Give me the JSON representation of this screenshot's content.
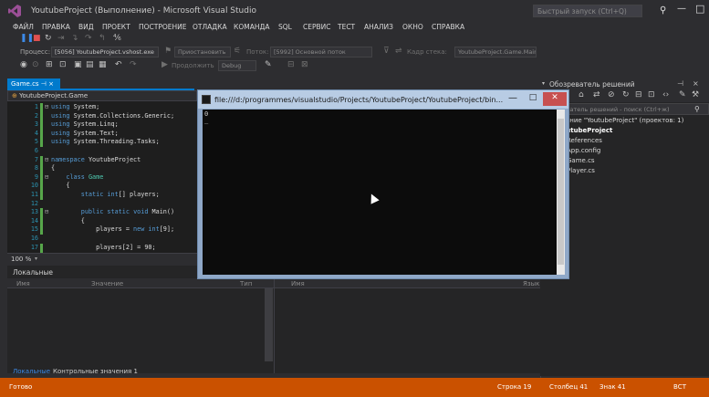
{
  "window": {
    "title": "YoutubeProject (Выполнение) - Microsoft Visual Studio",
    "quick_launch_placeholder": "Быстрый запуск (Ctrl+Q)"
  },
  "menu": [
    "ФАЙЛ",
    "ПРАВКА",
    "ВИД",
    "ПРОЕКТ",
    "ПОСТРОЕНИЕ",
    "ОТЛАДКА",
    "КОМАНДА",
    "SQL",
    "СЕРВИС",
    "ТЕСТ",
    "АНАЛИЗ",
    "ОКНО",
    "СПРАВКА"
  ],
  "toolbar": {
    "process_label": "Процесс:",
    "process_value": "[5056] YoutubeProject.vshost.exe",
    "lifecycle_label": "Приостановить",
    "thread_label": "Поток:",
    "thread_value": "[5992] Основной поток",
    "stack_label": "Кадр стека:",
    "stack_value": "YoutubeProject.Game.Main",
    "continue_label": "Продолжить",
    "config_value": "Debug"
  },
  "editor": {
    "tab_label": "Game.cs",
    "nav_value": "YoutubeProject.Game",
    "zoom": "100 %",
    "lines": [
      {
        "n": "1",
        "fold": "⊟",
        "chg": true,
        "code": "using System;"
      },
      {
        "n": "2",
        "fold": "",
        "chg": true,
        "code": "using System.Collections.Generic;"
      },
      {
        "n": "3",
        "fold": "",
        "chg": true,
        "code": "using System.Linq;"
      },
      {
        "n": "4",
        "fold": "",
        "chg": true,
        "code": "using System.Text;"
      },
      {
        "n": "5",
        "fold": "",
        "chg": true,
        "code": "using System.Threading.Tasks;"
      },
      {
        "n": "6",
        "fold": "",
        "chg": false,
        "code": ""
      },
      {
        "n": "7",
        "fold": "⊟",
        "chg": true,
        "code": "namespace YoutubeProject"
      },
      {
        "n": "8",
        "fold": "",
        "chg": true,
        "code": "{"
      },
      {
        "n": "9",
        "fold": "⊟",
        "chg": true,
        "code": "    class Game"
      },
      {
        "n": "10",
        "fold": "",
        "chg": true,
        "code": "    {"
      },
      {
        "n": "11",
        "fold": "",
        "chg": true,
        "code": "        static int[] players;"
      },
      {
        "n": "12",
        "fold": "",
        "chg": false,
        "code": ""
      },
      {
        "n": "13",
        "fold": "⊟",
        "chg": true,
        "code": "        public static void Main()"
      },
      {
        "n": "14",
        "fold": "",
        "chg": true,
        "code": "        {"
      },
      {
        "n": "15",
        "fold": "",
        "chg": true,
        "code": "            players = new int[9];"
      },
      {
        "n": "16",
        "fold": "",
        "chg": false,
        "code": ""
      },
      {
        "n": "17",
        "fold": "",
        "chg": true,
        "code": "            players[2] = 90;"
      }
    ]
  },
  "locals": {
    "title": "Локальные",
    "col_name": "Имя",
    "col_value": "Значение",
    "col_type": "Тип"
  },
  "pane2": {
    "col_name": "Имя",
    "col_lang": "Язык"
  },
  "bottom_tabs": {
    "locals": "Локальные",
    "watch": "Контрольные значения 1"
  },
  "solution_explorer": {
    "title": "Обозреватель решений",
    "search_placeholder": "Обозреватель решений - поиск (Ctrl+ж)",
    "items": [
      {
        "label": "Решение \"YoutubeProject\" (проектов: 1)",
        "icon": "▣",
        "color": "#d8d8d8"
      },
      {
        "label": "YoutubeProject",
        "icon": "◧",
        "color": "#ffffff",
        "bold": true
      },
      {
        "label": "References",
        "icon": "■",
        "color": "#d8d8d8"
      },
      {
        "label": "App.config",
        "icon": "▤",
        "color": "#d8d8d8"
      },
      {
        "label": "Game.cs",
        "icon": "c#",
        "color": "#d8d8d8"
      },
      {
        "label": "Player.cs",
        "icon": "c#",
        "color": "#d8d8d8"
      }
    ]
  },
  "console": {
    "title": "file:///d:/programmes/visualstudio/Projects/YoutubeProject/YoutubeProject/bin...",
    "output": "0\n_"
  },
  "statusbar": {
    "ready": "Готово",
    "line": "Строка 19",
    "col": "Столбец 41",
    "ch": "Знак 41",
    "mode": "ВСТ"
  },
  "colors": {
    "accent": "#007acc",
    "status_debug": "#ca5100",
    "keyword": "#569cd6",
    "type": "#4ec9b0"
  }
}
